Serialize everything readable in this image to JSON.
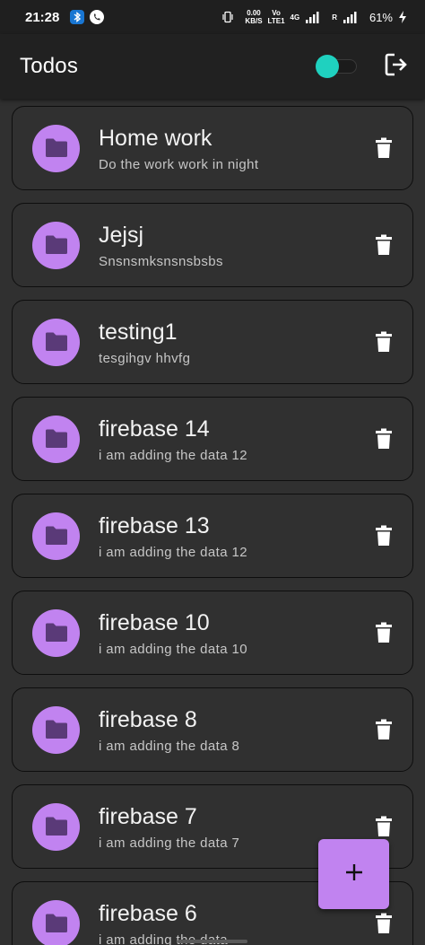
{
  "status_bar": {
    "time": "21:28",
    "speed_value": "0.00",
    "speed_unit": "KB/S",
    "volte_top": "Vo",
    "volte_bottom": "LTE1",
    "network": "4G",
    "roaming": "R",
    "battery": "61%",
    "icons": [
      "bluetooth-icon",
      "phone-call-icon",
      "vibrate-icon",
      "signal-icon",
      "charging-icon"
    ]
  },
  "app_bar": {
    "title": "Todos",
    "theme_toggle_on": true,
    "toggle_color": "#1fd1bf",
    "logout_icon": "logout-icon"
  },
  "todos": [
    {
      "title": "Home work",
      "subtitle": "Do the work work in night"
    },
    {
      "title": "Jejsj",
      "subtitle": "Snsnsmksnsnsbsbs"
    },
    {
      "title": "testing1",
      "subtitle": "tesgihgv hhvfg"
    },
    {
      "title": "firebase 14",
      "subtitle": "i am adding the data 12"
    },
    {
      "title": "firebase 13",
      "subtitle": "i am adding the data 12"
    },
    {
      "title": "firebase 10",
      "subtitle": "i am adding the data 10"
    },
    {
      "title": "firebase 8",
      "subtitle": "i am adding the data 8"
    },
    {
      "title": "firebase 7",
      "subtitle": "i am adding the data 7"
    },
    {
      "title": "firebase 6",
      "subtitle": "i am adding the data"
    }
  ],
  "fab": {
    "label": "+",
    "icon": "plus-icon"
  },
  "colors": {
    "accent": "#c183f0",
    "folder_icon": "#5a3a78",
    "background": "#303030",
    "app_bar": "#212121"
  }
}
